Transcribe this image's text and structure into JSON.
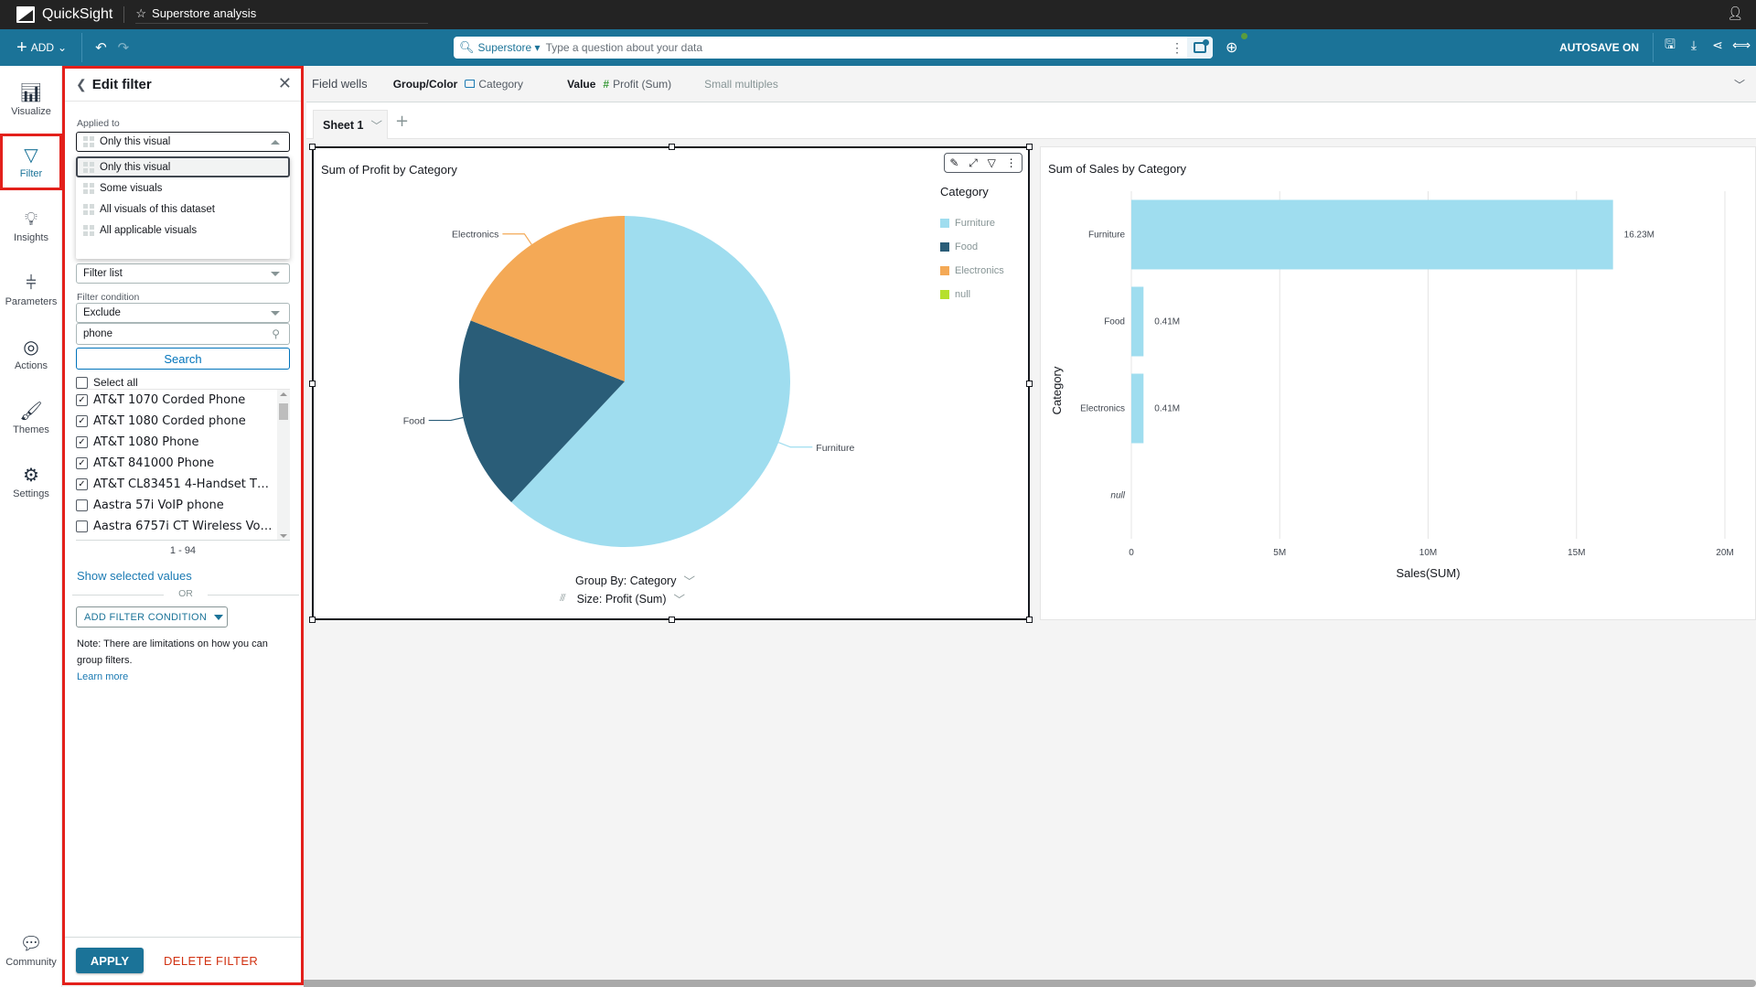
{
  "app": {
    "name": "QuickSight",
    "analysis_title": "Superstore analysis"
  },
  "toolbar": {
    "add_label": "ADD",
    "q_dataset": "Superstore",
    "q_placeholder": "Type a question about your data",
    "autosave_label": "AUTOSAVE ON",
    "icons": [
      "save-icon",
      "export-icon",
      "share-icon",
      "fit-width-icon"
    ]
  },
  "leftnav": {
    "items": [
      {
        "label": "Visualize",
        "icon": "visualize-icon"
      },
      {
        "label": "Filter",
        "icon": "filter-icon",
        "active": true
      },
      {
        "label": "Insights",
        "icon": "insights-icon"
      },
      {
        "label": "Parameters",
        "icon": "parameters-icon"
      },
      {
        "label": "Actions",
        "icon": "actions-icon"
      },
      {
        "label": "Themes",
        "icon": "themes-icon"
      },
      {
        "label": "Settings",
        "icon": "settings-icon"
      }
    ],
    "community": "Community"
  },
  "filter_panel": {
    "title": "Edit filter",
    "applied_to_label": "Applied to",
    "applied_to_value": "Only this visual",
    "applied_to_options": [
      "Only this visual",
      "Some visuals",
      "All visuals of this dataset",
      "All applicable visuals"
    ],
    "filter_type_value": "Filter list",
    "filter_condition_label": "Filter condition",
    "filter_condition_value": "Exclude",
    "search_value": "phone",
    "search_button": "Search",
    "select_all_label": "Select all",
    "values": [
      {
        "label": "AT&T 1070 Corded Phone",
        "checked": true
      },
      {
        "label": "AT&T 1080 Corded phone",
        "checked": true
      },
      {
        "label": "AT&T 1080 Phone",
        "checked": true
      },
      {
        "label": "AT&T 841000 Phone",
        "checked": true
      },
      {
        "label": "AT&T CL83451 4-Handset T…",
        "checked": true
      },
      {
        "label": "Aastra 57i VoIP phone",
        "checked": false
      },
      {
        "label": "Aastra 6757i CT Wireless Vo…",
        "checked": false
      }
    ],
    "pagination": "1 - 94",
    "show_selected": "Show selected values",
    "or_label": "OR",
    "add_condition": "ADD FILTER CONDITION",
    "note": "Note: There are limitations on how you can group filters.",
    "learn_more": "Learn more",
    "apply": "APPLY",
    "delete": "DELETE FILTER"
  },
  "field_wells": {
    "title": "Field wells",
    "group_label": "Group/Color",
    "group_value": "Category",
    "value_label": "Value",
    "value_value": "Profit (Sum)",
    "small_multiples": "Small multiples"
  },
  "sheets": {
    "tabs": [
      "Sheet 1"
    ]
  },
  "colors": {
    "furniture": "#9fddef",
    "food": "#2a5d78",
    "electronics": "#f4a956",
    "null": "#b6e02d",
    "brand": "#1b7398"
  },
  "chart_data": [
    {
      "type": "pie",
      "title": "Sum of Profit by Category",
      "legend_title": "Category",
      "legend_position": "right",
      "categories": [
        "Furniture",
        "Food",
        "Electronics",
        "null"
      ],
      "values": [
        62,
        19,
        19,
        0
      ],
      "value_unit": "percent share (estimated)",
      "group_by_label": "Group By: Category",
      "size_label": "Size: Profit (Sum)"
    },
    {
      "type": "bar",
      "orientation": "horizontal",
      "title": "Sum of Sales by Category",
      "categories": [
        "Furniture",
        "Food",
        "Electronics",
        "null"
      ],
      "values": [
        16.23,
        0.41,
        0.41,
        0
      ],
      "data_labels": [
        "16.23M",
        "0.41M",
        "0.41M",
        ""
      ],
      "xlabel": "Sales(SUM)",
      "ylabel": "Category",
      "xlim": [
        0,
        20
      ],
      "x_ticks": [
        "0",
        "5M",
        "10M",
        "15M",
        "20M"
      ],
      "grid": true
    }
  ]
}
